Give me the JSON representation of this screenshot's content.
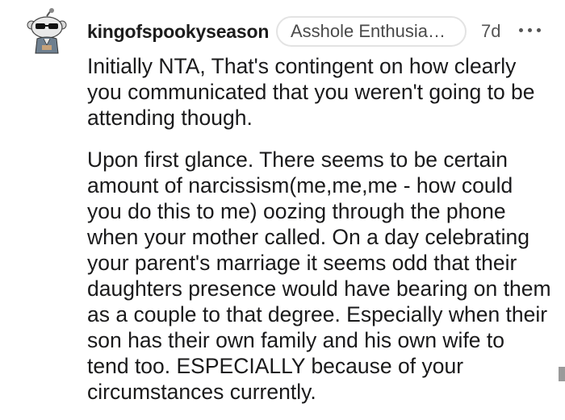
{
  "comment": {
    "username": "kingofspookyseason",
    "flair": "Asshole Enthusia…",
    "timestamp": "7d",
    "avatar_icon": "snoo-avatar-sunglasses-icon",
    "more_icon": "more-options-icon",
    "paragraphs": [
      "Initially NTA, That's contingent on how clearly you communicated that you weren't going to be attending though.",
      "Upon first glance. There seems to be certain amount of narcissism(me,me,me - how could you do this to me) oozing through the phone when your mother called. On a day celebrating your parent's marriage it seems odd that their daughters presence would have bearing on them as a couple to that degree. Especially when their son has their own family and his own wife to tend too. ESPECIALLY because of your circumstances currently."
    ]
  },
  "colors": {
    "text": "#1a1a1b",
    "meta": "#555555",
    "flair_border": "#e3e3e3",
    "background": "#ffffff"
  }
}
